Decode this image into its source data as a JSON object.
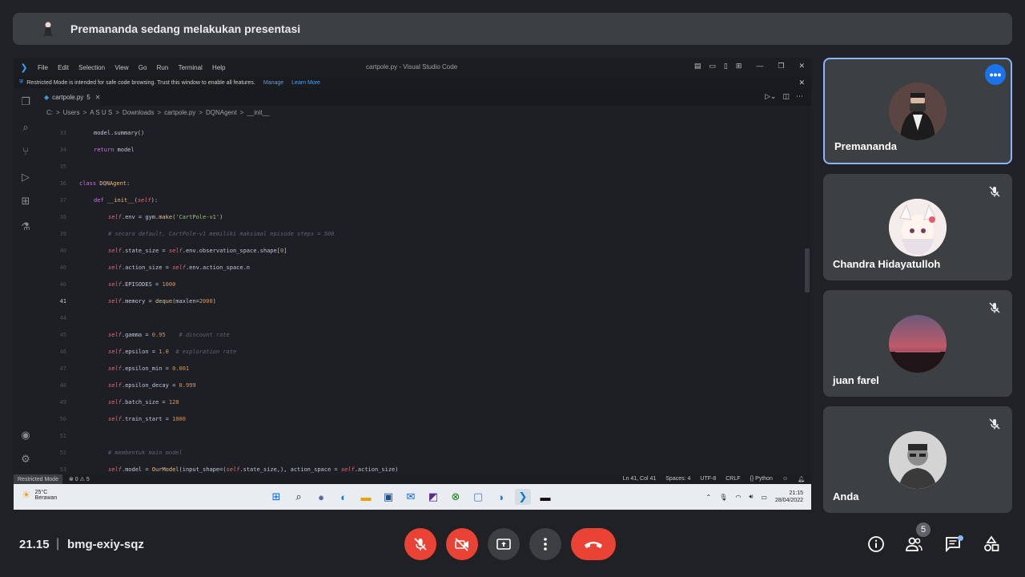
{
  "banner": {
    "text": "Premananda sedang melakukan presentasi"
  },
  "vscode": {
    "menu": [
      "File",
      "Edit",
      "Selection",
      "View",
      "Go",
      "Run",
      "Terminal",
      "Help"
    ],
    "window_title": "cartpole.py - Visual Studio Code",
    "restricted_text": "Restricted Mode is intended for safe code browsing. Trust this window to enable all features.",
    "restricted_manage": "Manage",
    "restricted_learn": "Learn More",
    "tab_name": "cartpole.py",
    "tab_problems": "5",
    "breadcrumb": [
      "C:",
      ">",
      "Users",
      ">",
      "A S U S",
      ">",
      "Downloads",
      ">",
      "cartpole.py",
      ">",
      "DQNAgent",
      ">",
      "__init__"
    ],
    "status_mode": "Restricted Mode",
    "status_errors": "0 ⚠ 5",
    "status_right": [
      "Ln 41, Col 41",
      "Spaces: 4",
      "UTF-8",
      "CRLF",
      "{} Python"
    ],
    "weather_temp": "25°C",
    "weather_desc": "Berawan",
    "clock_time": "21:15",
    "clock_date": "28/04/2022"
  },
  "participants": [
    {
      "name": "Premananda"
    },
    {
      "name": "Chandra Hidayatulloh"
    },
    {
      "name": "juan farel"
    },
    {
      "name": "Anda"
    }
  ],
  "bottom": {
    "time": "21.15",
    "separator": "|",
    "meeting_code": "bmg-exiy-sqz",
    "participant_count": "5"
  },
  "colors": {
    "accent": "#8ab4f8",
    "danger": "#ea4335",
    "tile_bg": "#3c4043",
    "page_bg": "#202124"
  }
}
